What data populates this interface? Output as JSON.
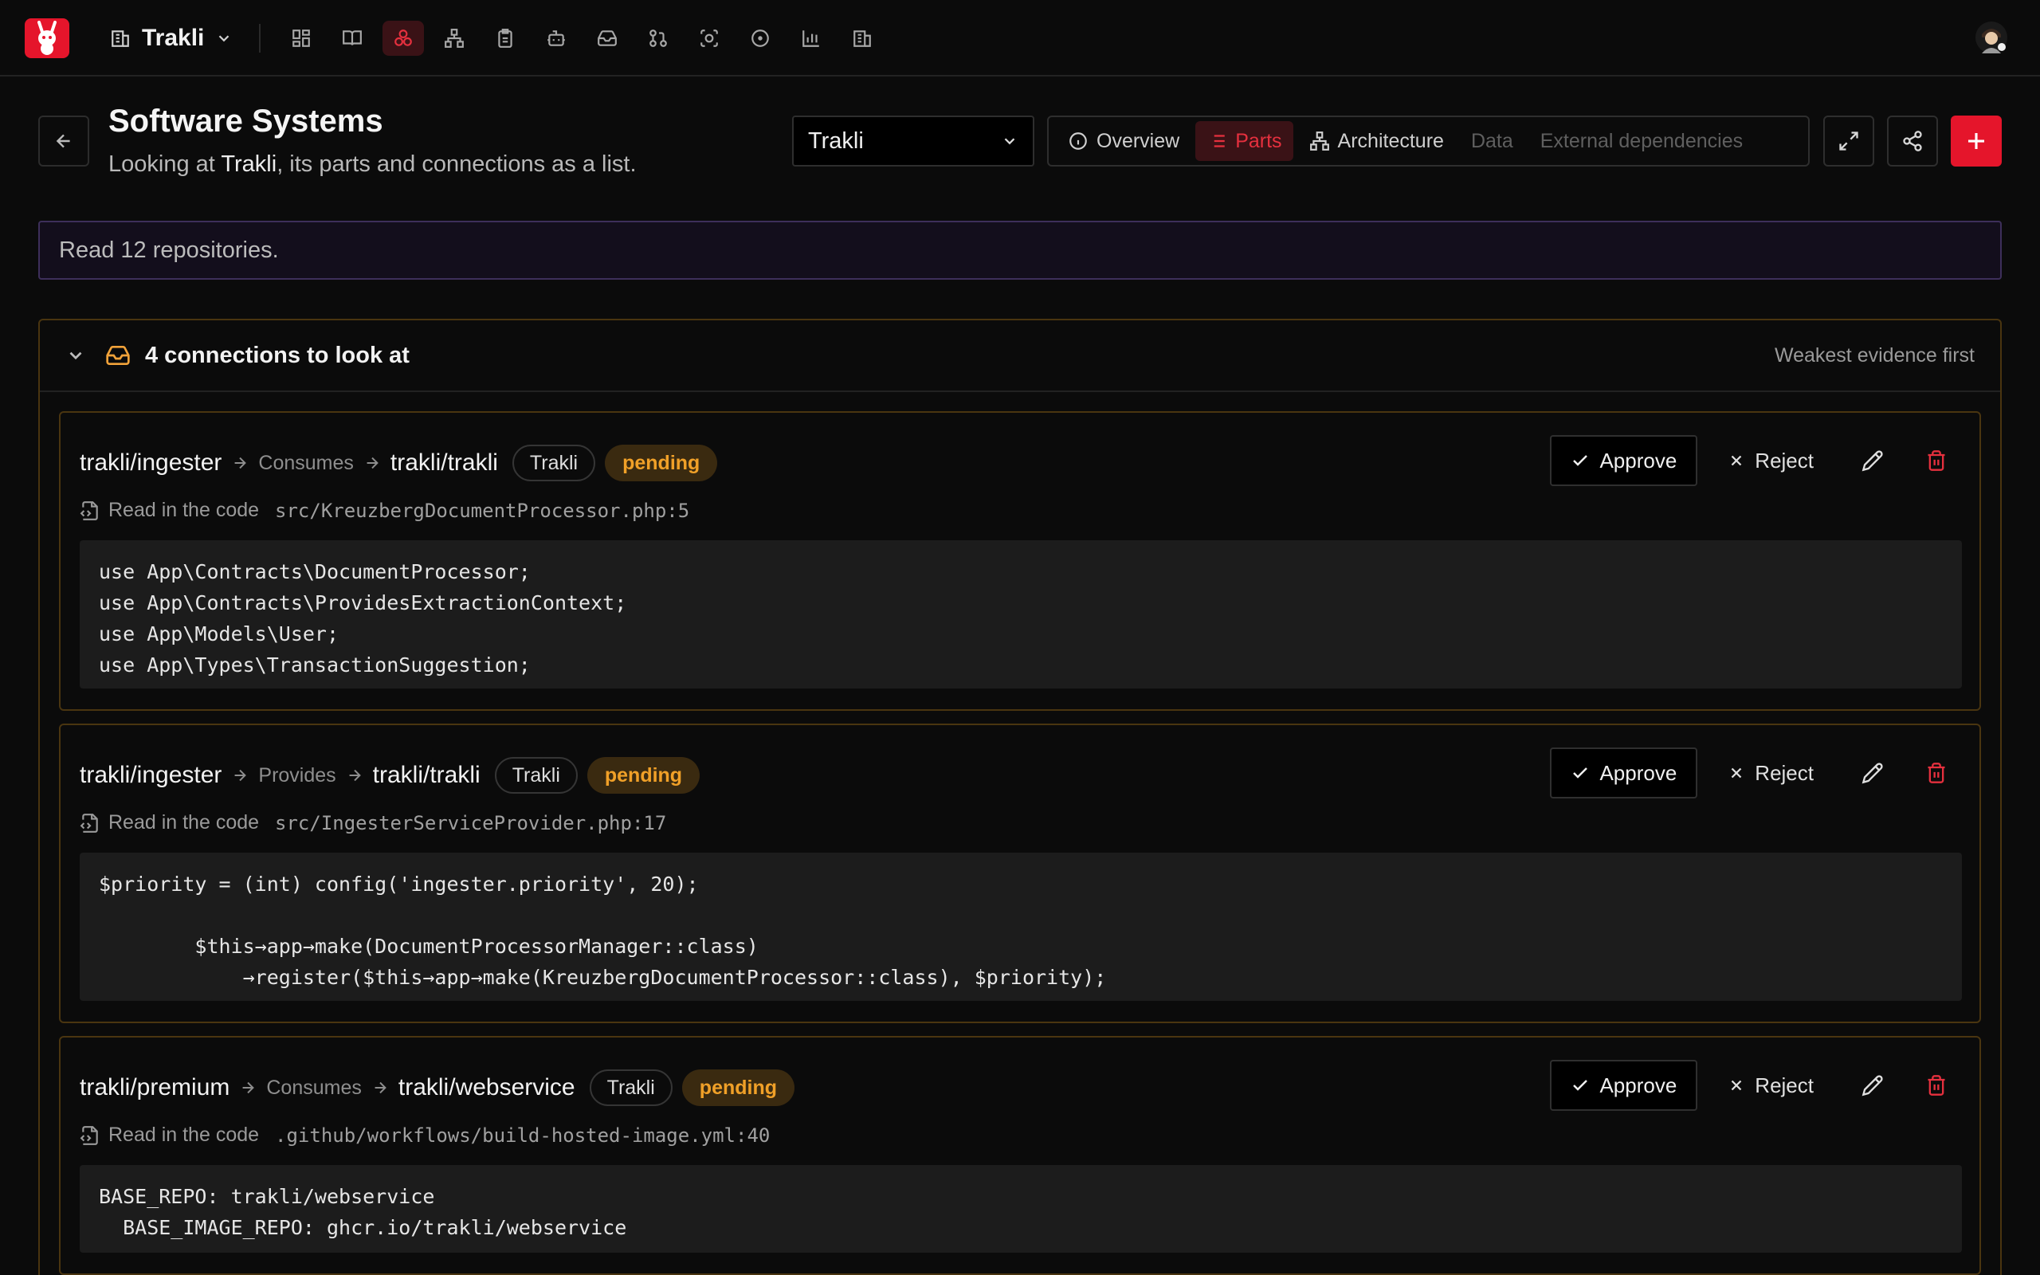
{
  "nav": {
    "org_name": "Trakli",
    "icons": [
      "dashboard-icon",
      "book-icon",
      "systems-icon",
      "hierarchy-icon",
      "clipboard-icon",
      "bot-icon",
      "inbox-icon",
      "git-pull-request-icon",
      "scan-icon",
      "circle-dot-icon",
      "bar-chart-icon",
      "building-icon"
    ],
    "active_icon": "systems-icon",
    "accent": "#e5152b"
  },
  "header": {
    "title": "Software Systems",
    "subtitle_prefix": "Looking at",
    "subtitle_system": "Trakli",
    "subtitle_suffix": ", its parts and connections as a list.",
    "system_select_value": "Trakli",
    "tabs": [
      {
        "label": "Overview",
        "state": "normal"
      },
      {
        "label": "Parts",
        "state": "active"
      },
      {
        "label": "Architecture",
        "state": "normal"
      },
      {
        "label": "Data",
        "state": "disabled"
      },
      {
        "label": "External dependencies",
        "state": "disabled"
      }
    ]
  },
  "banner": {
    "text": "Read 12 repositories."
  },
  "review": {
    "title": "4 connections to look at",
    "sort_label": "Weakest evidence first",
    "approve_label": "Approve",
    "reject_label": "Reject",
    "evidence_label": "Read in the code",
    "cards": [
      {
        "source": "trakli/ingester",
        "relation": "Consumes",
        "target": "trakli/trakli",
        "system": "Trakli",
        "status": "pending",
        "path": "src/KreuzbergDocumentProcessor.php:5",
        "code": "use App\\Contracts\\DocumentProcessor;\nuse App\\Contracts\\ProvidesExtractionContext;\nuse App\\Models\\User;\nuse App\\Types\\TransactionSuggestion;"
      },
      {
        "source": "trakli/ingester",
        "relation": "Provides",
        "target": "trakli/trakli",
        "system": "Trakli",
        "status": "pending",
        "path": "src/IngesterServiceProvider.php:17",
        "code": "$priority = (int) config('ingester.priority', 20);\n\n        $this→app→make(DocumentProcessorManager::class)\n            →register($this→app→make(KreuzbergDocumentProcessor::class), $priority);"
      },
      {
        "source": "trakli/premium",
        "relation": "Consumes",
        "target": "trakli/webservice",
        "system": "Trakli",
        "status": "pending",
        "path": ".github/workflows/build-hosted-image.yml:40",
        "code": "BASE_REPO: trakli/webservice\n  BASE_IMAGE_REPO: ghcr.io/trakli/webservice"
      }
    ]
  }
}
